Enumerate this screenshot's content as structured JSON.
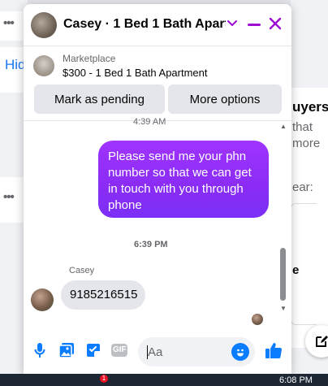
{
  "background": {
    "hidden_link": "Hid",
    "right_texts": [
      "uyers",
      "that",
      "more",
      "ear:",
      "e"
    ]
  },
  "chat": {
    "title": "Casey · 1 Bed 1 Bath Apart…",
    "listing": {
      "source": "Marketplace",
      "title": "$300 - 1 Bed 1 Bath Apartment",
      "mark_pending_label": "Mark as pending",
      "more_options_label": "More options"
    },
    "messages": {
      "top_timestamp": "4:39 AM",
      "outgoing_text": "Please send me your phn number so that we can get in touch with you through phone",
      "mid_timestamp": "6:39 PM",
      "sender_name": "Casey",
      "incoming_text": "9185216515"
    },
    "composer": {
      "placeholder": "Aa",
      "gif_label": "GIF"
    }
  },
  "taskbar": {
    "badge_count": "1",
    "time": "6:08 PM"
  },
  "colors": {
    "accent": "#9d0bd3",
    "bubble_out": "#8a2cf5",
    "icon_blue": "#0a7cff",
    "link_blue": "#1877f2"
  }
}
